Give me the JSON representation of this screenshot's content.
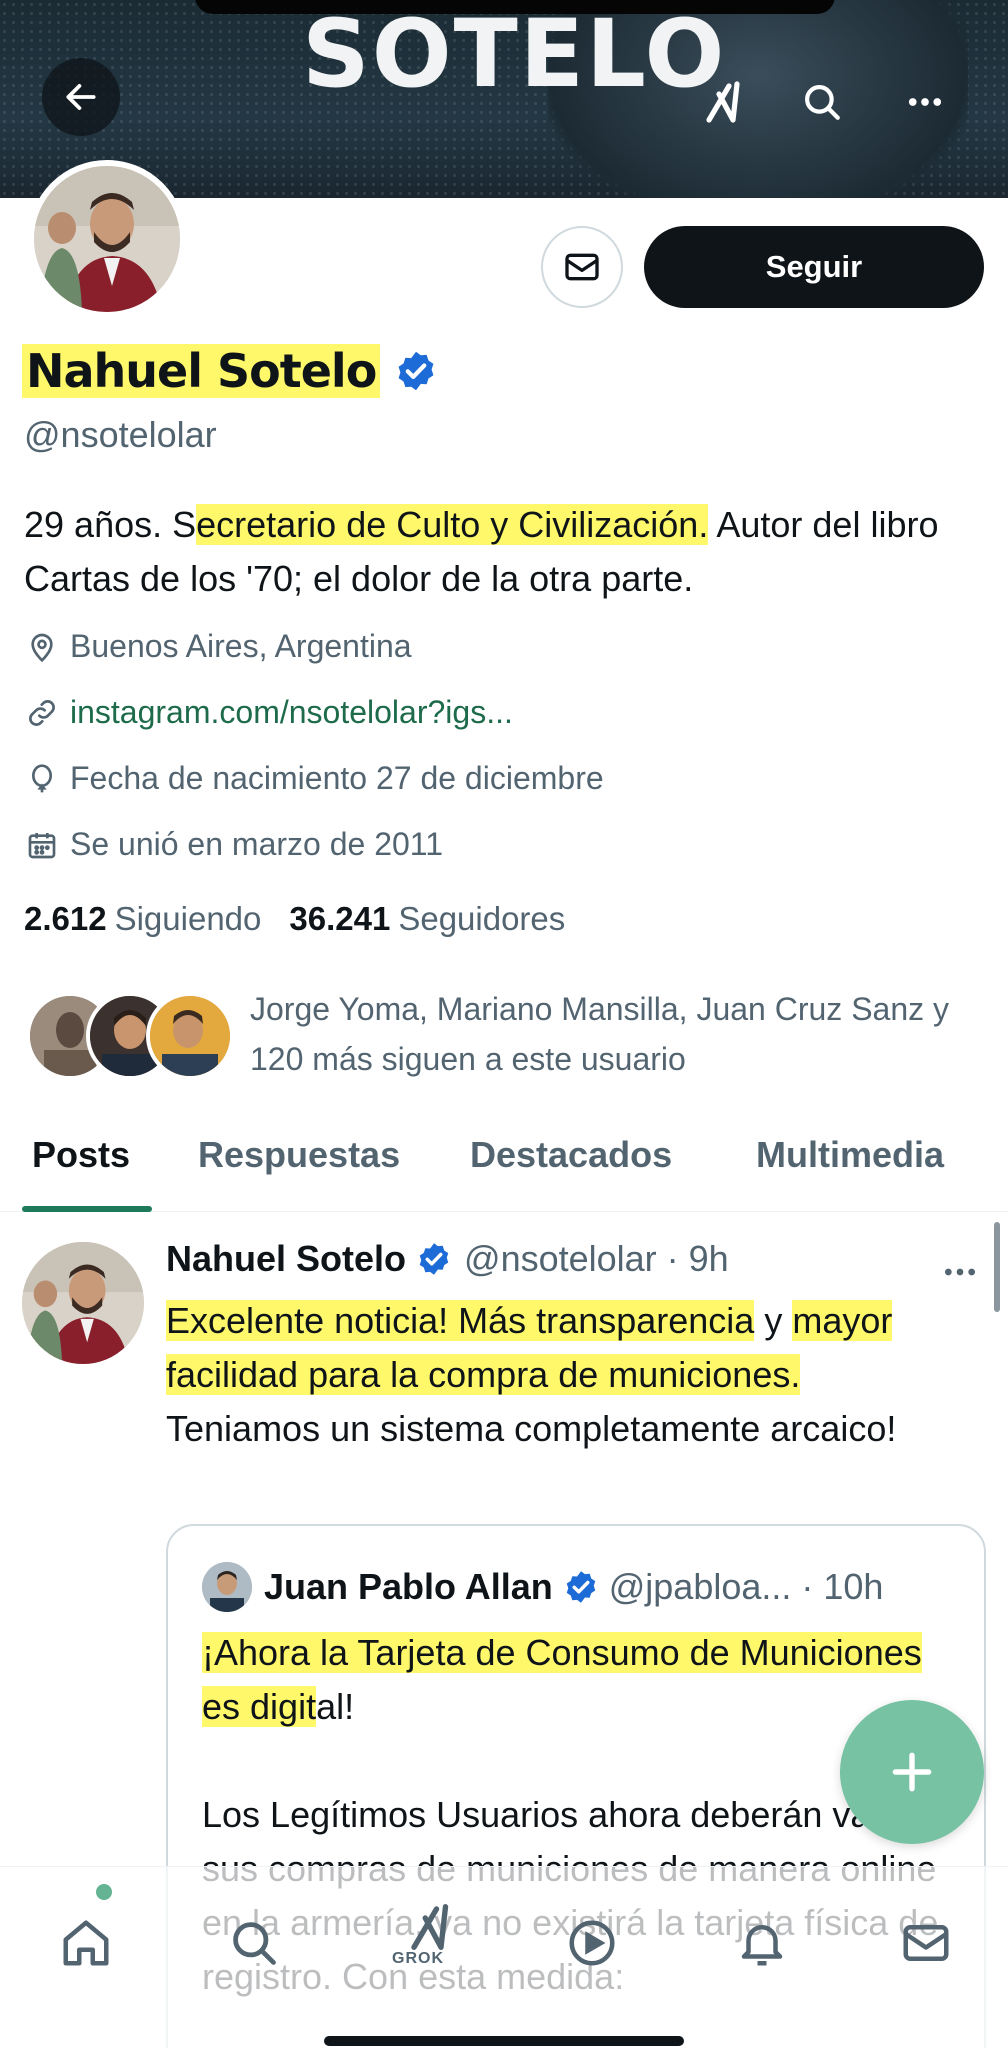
{
  "header": {
    "banner_text": "SOTELO",
    "back_icon": "arrow-left-icon",
    "grok_icon": "grok-logo-icon",
    "search_icon": "search-icon",
    "more_icon": "more-horizontal-icon"
  },
  "profile": {
    "name": "Nahuel Sotelo",
    "handle": "@nsotelolar",
    "bio_before": "29 años. S",
    "bio_highlight": "ecretario de Culto y Civilización.",
    "bio_after": " Autor del libro Cartas de los '70; el dolor de la otra parte.",
    "location": "Buenos Aires, Argentina",
    "website": "instagram.com/nsotelolar?igs...",
    "birthday": "Fecha de nacimiento 27 de diciembre",
    "joined": "Se unió en marzo de 2011",
    "following_count": "2.612",
    "following_label": "Siguiendo",
    "followers_count": "36.241",
    "followers_label": "Seguidores",
    "followed_by": "Jorge Yoma, Mariano Mansilla, Juan Cruz Sanz y 120 más siguen a este usuario",
    "follow_label": "Seguir"
  },
  "tabs": [
    "Posts",
    "Respuestas",
    "Destacados",
    "Multimedia"
  ],
  "post": {
    "author": "Nahuel Sotelo",
    "meta": "@nsotelolar · 9h",
    "text_highlight_1": "Excelente noticia! Más transparencia",
    "text_mid": " y ",
    "text_highlight_2": "mayor facilidad para la compra de municiones.",
    "text_after": " Teniamos un sistema completamente arcaico!",
    "quote": {
      "author": "Juan Pablo Allan",
      "meta": "@jpabloa... · 10h",
      "text1_highlight": "¡Ahora la Tarjeta de Consumo de Municiones es digit",
      "text1_after": "al!",
      "text2": "Los Legítimos Usuarios ahora deberán validar sus compras de municiones de manera online en la armería, ya no existirá la tarjeta física de registro. Con esta medida:"
    }
  },
  "nav": {
    "grok_label": "GROK"
  },
  "colors": {
    "highlight": "#fff86a",
    "follow_button": "#0f1419",
    "accent_green": "#1d7a5a",
    "fab": "#76c2a2",
    "verified": "#1d6bd6"
  }
}
